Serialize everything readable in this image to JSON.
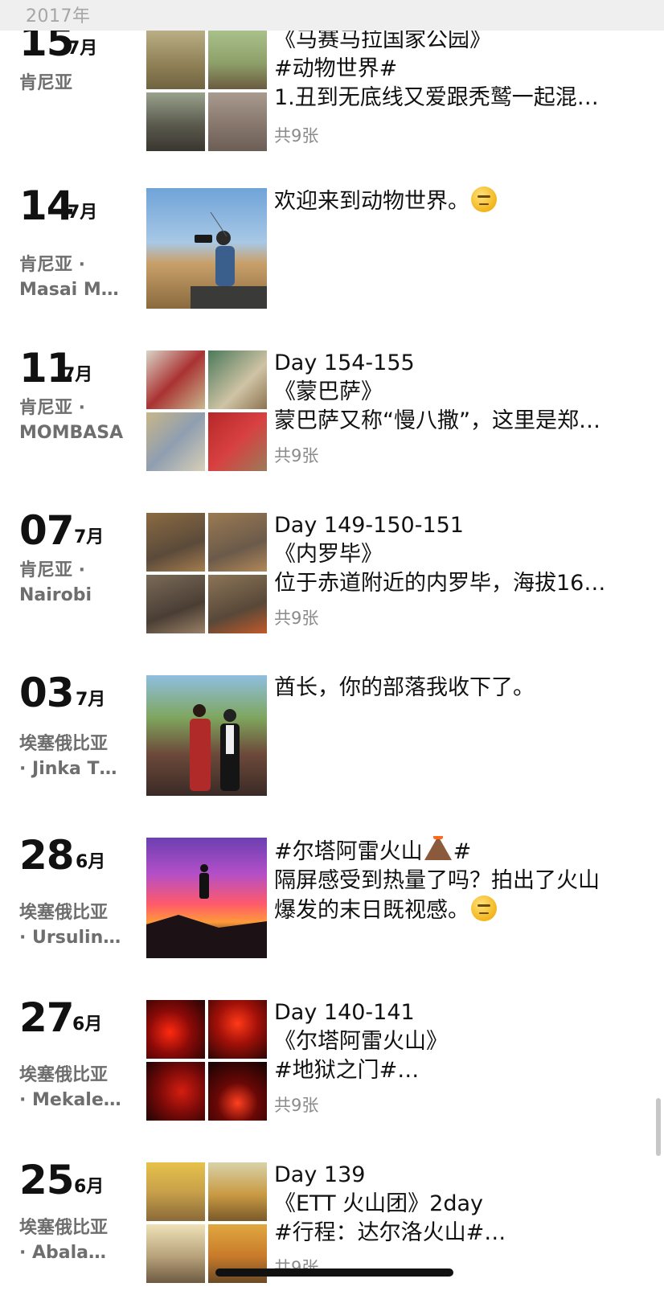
{
  "year_header": "2017年",
  "entries": [
    {
      "day": "15",
      "month": "7月",
      "location_line1": "肯尼亚",
      "location_line2": "",
      "text_lines": [
        "《马赛马拉国家公园》",
        "#动物世界#",
        "1.丑到无底线又爱跟秃鹫一起混…"
      ],
      "photo_count": "共9张",
      "photos": [
        "savanna-vultures",
        "savanna-warthog",
        "buffalo",
        "hippos"
      ]
    },
    {
      "day": "14",
      "month": "7月",
      "location_line1": "肯尼亚 ·",
      "location_line2": "Masai M…",
      "text_lines": [
        "欢迎来到动物世界。"
      ],
      "text_emoji": "smirk-emoji",
      "photo_count": "",
      "photos": [
        "man-with-camera-on-safari"
      ]
    },
    {
      "day": "11",
      "month": "7月",
      "location_line1": "肯尼亚 ·",
      "location_line2": "MOMBASA",
      "text_lines": [
        "Day 154-155",
        "《蒙巴萨》",
        "蒙巴萨又称“慢八撒”，这里是郑…"
      ],
      "photo_count": "共9张",
      "photos": [
        "street-shop",
        "street-storefront",
        "street-wall",
        "street-red-kiosk"
      ]
    },
    {
      "day": "07",
      "month": "7月",
      "location_line1": "肯尼亚 ·",
      "location_line2": "Nairobi",
      "text_lines": [
        "Day 149-150-151",
        "《内罗毕》",
        "位于赤道附近的内罗毕，海拔16…"
      ],
      "photo_count": "共9张",
      "photos": [
        "cart-pusher",
        "cart-loaded",
        "handcart",
        "motorbike-cargo"
      ]
    },
    {
      "day": "03",
      "month": "7月",
      "location_line1": "埃塞俄比亚",
      "location_line2": "· Jinka T…",
      "text_lines": [
        "酋长，你的部落我收下了。"
      ],
      "photo_count": "",
      "photos": [
        "tribe-portrait"
      ]
    },
    {
      "day": "28",
      "month": "6月",
      "location_line1": "埃塞俄比亚",
      "location_line2": "· Ursulin…",
      "text_lines": [
        "#尔塔阿雷火山",
        "隔屏感受到热量了吗？拍出了火山",
        "爆发的末日既视感。"
      ],
      "text_icon": "volcano-icon",
      "text_line1_suffix": "#",
      "text_emoji": "smirk-emoji",
      "photo_count": "",
      "photos": [
        "volcano-sunset-silhouette"
      ]
    },
    {
      "day": "27",
      "month": "6月",
      "location_line1": "埃塞俄比亚",
      "location_line2": "· Mekale…",
      "text_lines": [
        "Day 140-141",
        "《尔塔阿雷火山》",
        "#地狱之门#…"
      ],
      "photo_count": "共9张",
      "photos": [
        "lava-1",
        "lava-2",
        "lava-3",
        "lava-4"
      ]
    },
    {
      "day": "25",
      "month": "6月",
      "location_line1": "埃塞俄比亚",
      "location_line2": "· Abala…",
      "text_lines": [
        "Day 139",
        "《ETT 火山团》2day",
        "#行程：达尔洛火山#…"
      ],
      "photo_count": "共9张",
      "photos": [
        "salt-flat-1",
        "salt-flat-2",
        "salt-flat-3",
        "salt-flat-4"
      ]
    }
  ]
}
